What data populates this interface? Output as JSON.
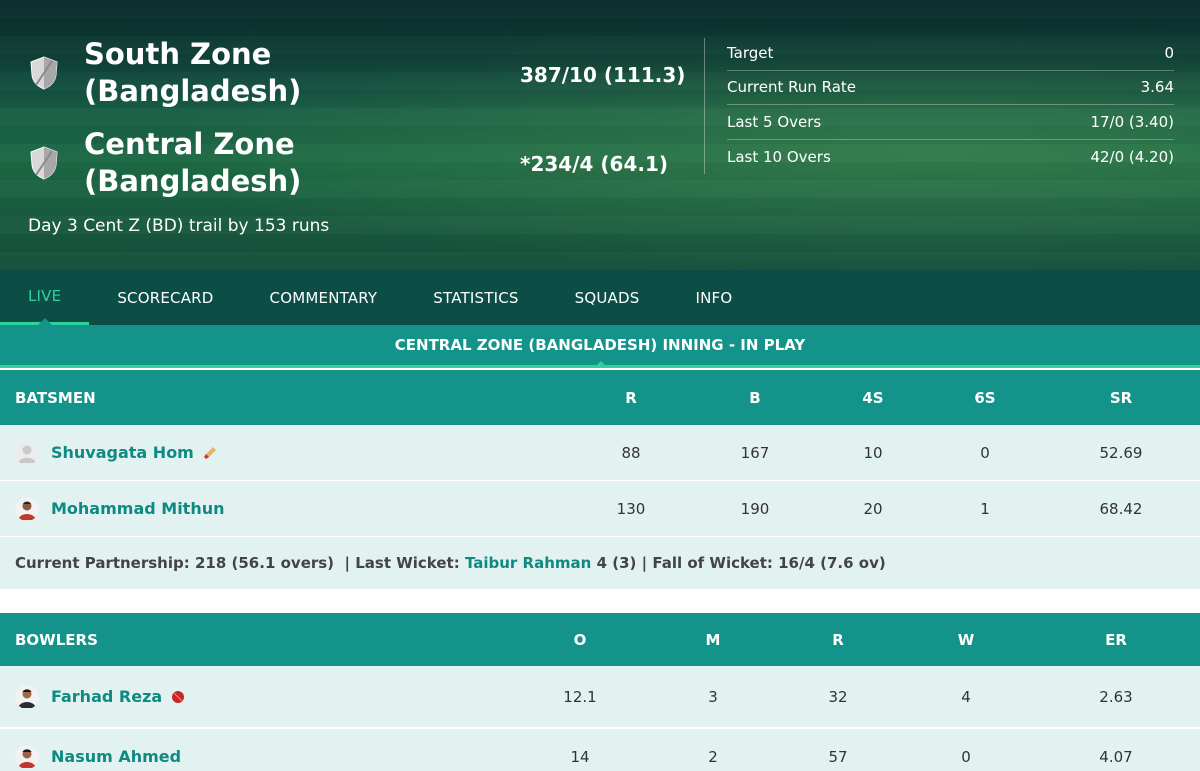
{
  "header": {
    "team1": {
      "name": "South Zone (Bangladesh)",
      "score": "387/10 (111.3)"
    },
    "team2": {
      "name": "Central Zone (Bangladesh)",
      "score": "*234/4 (64.1)"
    },
    "status": "Day 3 Cent Z (BD) trail by 153 runs",
    "stats": [
      {
        "label": "Target",
        "value": "0"
      },
      {
        "label": "Current Run Rate",
        "value": "3.64"
      },
      {
        "label": "Last 5 Overs",
        "value": "17/0 (3.40)"
      },
      {
        "label": "Last 10 Overs",
        "value": "42/0 (4.20)"
      }
    ]
  },
  "tabs": [
    "LIVE",
    "SCORECARD",
    "COMMENTARY",
    "STATISTICS",
    "SQUADS",
    "INFO"
  ],
  "active_tab": "LIVE",
  "innings_title": "CENTRAL ZONE (BANGLADESH) INNING - IN PLAY",
  "batsmen": {
    "headers": [
      "BATSMEN",
      "R",
      "B",
      "4S",
      "6S",
      "SR"
    ],
    "rows": [
      {
        "name": "Shuvagata Hom",
        "r": "88",
        "b": "167",
        "fours": "10",
        "sixes": "0",
        "sr": "52.69",
        "icon": "bat-icon"
      },
      {
        "name": "Mohammad Mithun",
        "r": "130",
        "b": "190",
        "fours": "20",
        "sixes": "1",
        "sr": "68.42"
      }
    ]
  },
  "partnership": {
    "current_label": "Current Partnership:",
    "current_value": "218 (56.1 overs)",
    "sep1": "|",
    "last_wicket_label": "Last Wicket:",
    "last_wicket_name": "Taibur Rahman",
    "last_wicket_score": "4 (3)",
    "sep2": "|",
    "fow_label": "Fall of Wicket:",
    "fow_value": "16/4 (7.6 ov)"
  },
  "bowlers": {
    "headers": [
      "BOWLERS",
      "O",
      "M",
      "R",
      "W",
      "ER"
    ],
    "rows": [
      {
        "name": "Farhad Reza",
        "o": "12.1",
        "m": "3",
        "r": "32",
        "w": "4",
        "er": "2.63",
        "icon": "ball-icon"
      },
      {
        "name": "Nasum Ahmed",
        "o": "14",
        "m": "2",
        "r": "57",
        "w": "0",
        "er": "4.07"
      }
    ]
  },
  "colors": {
    "teal": "#14938a",
    "dark_teal": "#0c4e46",
    "accent": "#2ed39b",
    "row_bg": "#e2f2f0",
    "link": "#0e8a83"
  }
}
